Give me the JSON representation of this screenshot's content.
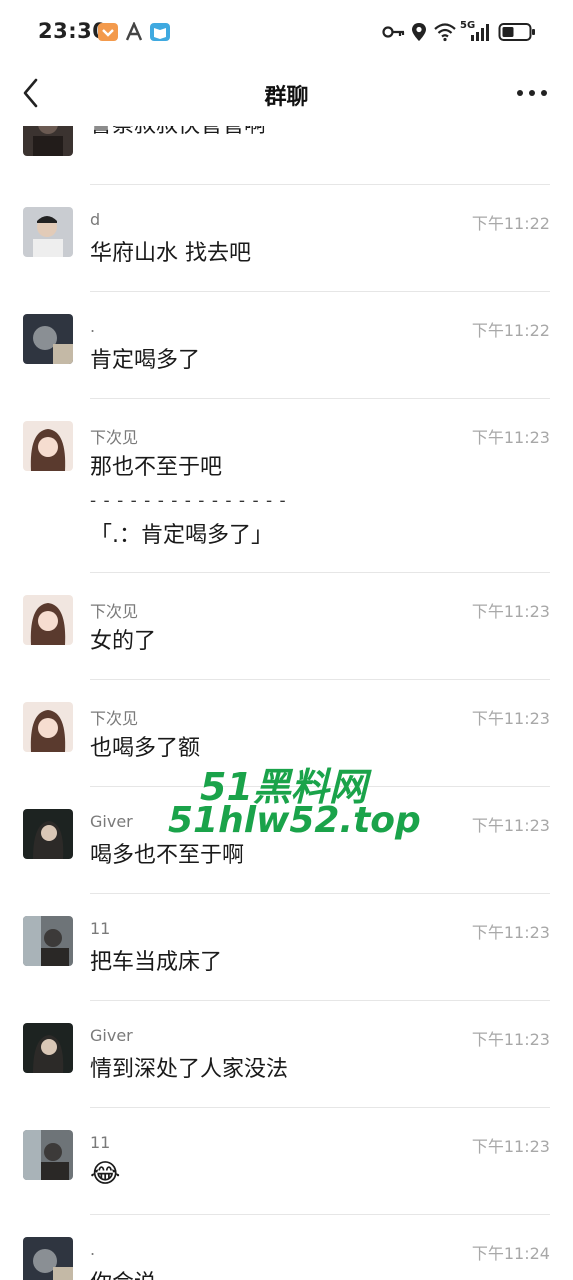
{
  "status_bar": {
    "time": "23:30",
    "network": "5G"
  },
  "header": {
    "title": "群聊"
  },
  "messages": [
    {
      "sender": "",
      "time": "",
      "text": "警察叔叔快管管啊",
      "avatar": "avatar-dark"
    },
    {
      "sender": "d",
      "time": "下午11:22",
      "text": "华府山水 找去吧",
      "avatar": "avatar-man"
    },
    {
      "sender": ".",
      "time": "下午11:22",
      "text": "肯定喝多了",
      "avatar": "avatar-dark"
    },
    {
      "sender": "下次见",
      "time": "下午11:23",
      "text": "那也不至于吧",
      "quote_sep": "- - - - - - - - - - - - - - -",
      "quote": "「.：肯定喝多了」",
      "avatar": "avatar-girl"
    },
    {
      "sender": "下次见",
      "time": "下午11:23",
      "text": "女的了",
      "avatar": "avatar-girl"
    },
    {
      "sender": "下次见",
      "time": "下午11:23",
      "text": "也喝多了额",
      "avatar": "avatar-girl"
    },
    {
      "sender": "Giver",
      "time": "下午11:23",
      "text": "喝多也不至于啊",
      "avatar": "avatar-night"
    },
    {
      "sender": "11",
      "time": "下午11:23",
      "text": "把车当成床了",
      "avatar": "avatar-street"
    },
    {
      "sender": "Giver",
      "time": "下午11:23",
      "text": "情到深处了人家没法",
      "avatar": "avatar-night"
    },
    {
      "sender": "11",
      "time": "下午11:23",
      "text": "😂",
      "avatar": "avatar-street"
    },
    {
      "sender": ".",
      "time": "下午11:24",
      "text": "你会说",
      "avatar": "avatar-dark"
    }
  ],
  "watermark": {
    "line1": "51黑料网",
    "line2": "51hlw52.top",
    "color": "#1aa34a"
  }
}
